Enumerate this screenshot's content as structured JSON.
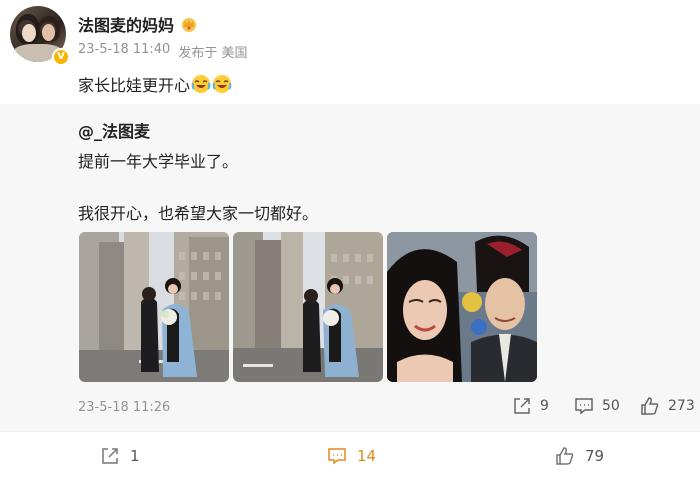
{
  "post": {
    "author": "法图麦的妈妈",
    "timestamp": "23-5-18 11:40",
    "published_from": "发布于 美国",
    "text": "家长比娃更开心",
    "emoji_count": 2
  },
  "repost": {
    "author": "@_法图麦",
    "line1": "提前一年大学毕业了。",
    "line2": "我很开心，也希望大家一切都好。",
    "timestamp": "23-5-18 11:26",
    "stats": {
      "shares": "9",
      "comments": "50",
      "likes": "273"
    }
  },
  "actions": {
    "share": "1",
    "comment": "14",
    "like": "79"
  },
  "colors": {
    "accent": "#e08a1e",
    "verified": "#f7b500",
    "muted": "#939393"
  }
}
